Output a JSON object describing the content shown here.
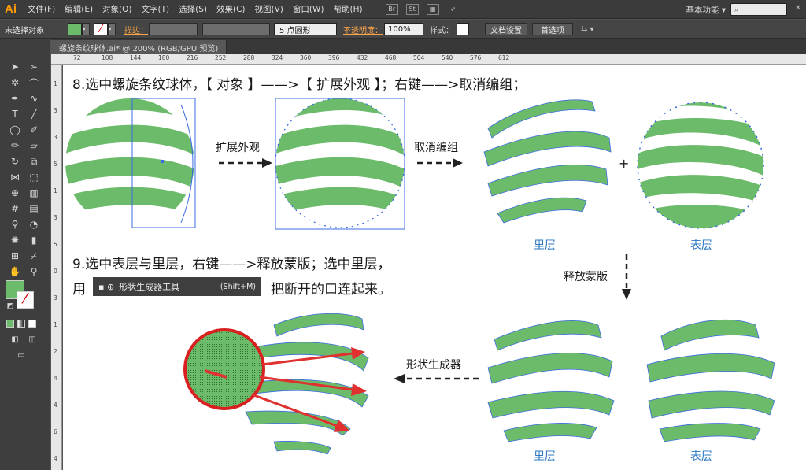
{
  "app": {
    "logo": "Ai",
    "workspace": "基本功能 ▾"
  },
  "menu": [
    "文件(F)",
    "编辑(E)",
    "对象(O)",
    "文字(T)",
    "选择(S)",
    "效果(C)",
    "视图(V)",
    "窗口(W)",
    "帮助(H)"
  ],
  "menu_icons": [
    "Br",
    "St"
  ],
  "control": {
    "selection": "未选择对象",
    "stroke_label": "描边：",
    "brush": "5 点圆形",
    "opacity_label": "不透明度：",
    "opacity": "100%",
    "style_label": "样式：",
    "doc_setup": "文档设置",
    "prefs": "首选项"
  },
  "document": {
    "tab": "螺旋条纹球体.ai* @ 200% (RGB/GPU 预览)"
  },
  "ruler": {
    "h": [
      "72",
      "108",
      "144",
      "180",
      "216",
      "252",
      "288",
      "324",
      "360",
      "396",
      "432",
      "468",
      "504",
      "540",
      "576",
      "612"
    ],
    "v": [
      "1",
      "3",
      "3",
      "5",
      "1",
      "3",
      "5",
      "0",
      "3",
      "1",
      "2",
      "4",
      "4",
      "6",
      "4"
    ]
  },
  "tutorial": {
    "step8": "8.选中螺旋条纹球体，【 对象 】——>【 扩展外观 】；右键——>取消编组；",
    "expand": "扩展外观",
    "ungroup": "取消编组",
    "plus": "+",
    "inner1": "里层",
    "outer1": "表层",
    "step9a": "9.选中表层与里层，右键——>释放蒙版；选中里层，",
    "step9b_use": "用",
    "tool_name": "形状生成器工具",
    "tool_shortcut": "(Shift+M)",
    "step9b_rest": "把断开的口连起来。",
    "release": "释放蒙版",
    "shape_builder": "形状生成器",
    "inner2": "里层",
    "outer2": "表层"
  },
  "colors": {
    "accent": "#6cbb6b",
    "anchor": "#3b6be0",
    "arrow": "#e03030",
    "label_blue": "#2a78c2"
  }
}
